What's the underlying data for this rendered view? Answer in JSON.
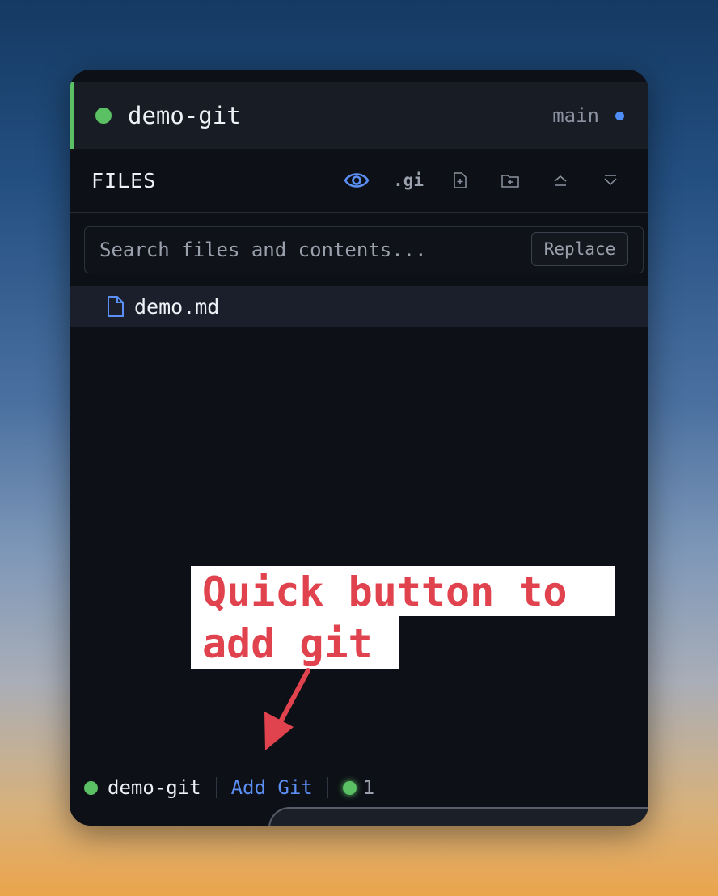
{
  "header": {
    "project_name": "demo-git",
    "branch": "main"
  },
  "files": {
    "title": "FILES",
    "actions": [
      "eye-icon",
      ".gi",
      "new-file-icon",
      "new-folder-icon",
      "collapse-icon",
      "expand-icon"
    ],
    "gi_label": ".gi"
  },
  "search": {
    "placeholder": "Search files and contents...",
    "replace_label": "Replace"
  },
  "file_list": [
    {
      "name": "demo.md",
      "icon": "file-icon"
    }
  ],
  "annotation": {
    "line1": "Quick button to",
    "line2": "add git"
  },
  "status_bar": {
    "project_name": "demo-git",
    "add_git_label": "Add Git",
    "count": "1"
  },
  "colors": {
    "accent_green": "#5bc064",
    "accent_blue": "#4f8ef7",
    "annotation_red": "#e0434d"
  }
}
